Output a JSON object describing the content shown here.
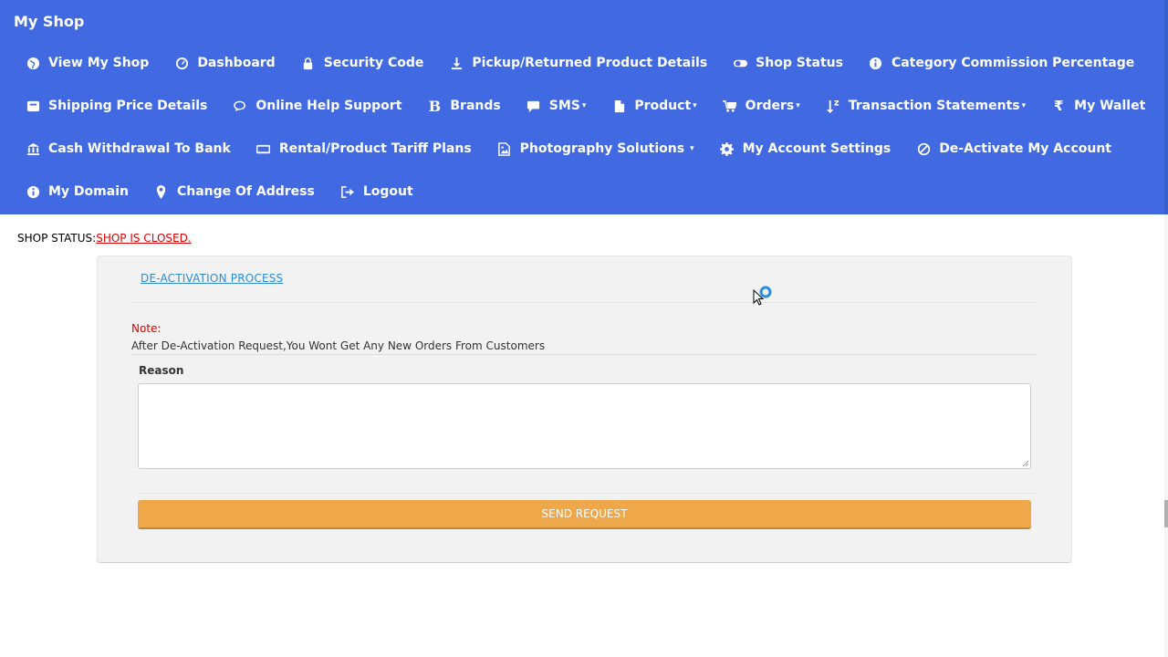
{
  "navbar": {
    "brand": "My Shop",
    "rows": [
      [
        {
          "label": "View My Shop",
          "icon": "globe-icon"
        },
        {
          "label": "Dashboard",
          "icon": "dashboard-icon"
        },
        {
          "label": "Security Code",
          "icon": "lock-icon"
        },
        {
          "label": "Pickup/Returned Product Details",
          "icon": "download-icon"
        },
        {
          "label": "Shop Status",
          "icon": "toggle-icon"
        },
        {
          "label": "Category Commission Percentage",
          "icon": "info-icon"
        }
      ],
      [
        {
          "label": "Shipping Price Details",
          "icon": "shipping-icon"
        },
        {
          "label": "Online Help Support",
          "icon": "chat-icon"
        },
        {
          "label": "Brands",
          "icon": "bold-b-icon"
        },
        {
          "label": "SMS",
          "icon": "comment-icon",
          "caret": "▾"
        },
        {
          "label": "Product",
          "icon": "file-icon",
          "caret": "▾"
        },
        {
          "label": "Orders",
          "icon": "cart-icon",
          "caret": "▾"
        },
        {
          "label": "Transaction Statements",
          "icon": "sort-icon",
          "caret": "▾"
        },
        {
          "label": "My Wallet",
          "icon": "rupee-icon"
        }
      ],
      [
        {
          "label": "Cash Withdrawal To Bank",
          "icon": "bank-icon"
        },
        {
          "label": "Rental/Product Tariff Plans",
          "icon": "credit-card-icon"
        },
        {
          "label": "Photography Solutions",
          "icon": "image-icon",
          "caret": "▾"
        },
        {
          "label": "My Account Settings",
          "icon": "gear-icon"
        },
        {
          "label": "De-Activate My Account",
          "icon": "ban-icon"
        }
      ],
      [
        {
          "label": "My Domain",
          "icon": "info-icon"
        },
        {
          "label": "Change Of Address",
          "icon": "map-marker-icon"
        },
        {
          "label": "Logout",
          "icon": "logout-icon"
        }
      ]
    ]
  },
  "status": {
    "label": "SHOP STATUS:",
    "value": "SHOP IS CLOSED."
  },
  "panel": {
    "process_link": "DE-ACTIVATION PROCESS",
    "note_label": "Note:",
    "note_text": "After De-Activation Request,You Wont Get Any New Orders From Customers",
    "reason_label": "Reason",
    "reason_value": "",
    "send_button": "SEND REQUEST"
  },
  "colors": {
    "navbar": "#4169e1",
    "button": "#eea84a",
    "link": "#2f8ad6",
    "status_closed": "#dd0000",
    "note": "#e00000"
  }
}
